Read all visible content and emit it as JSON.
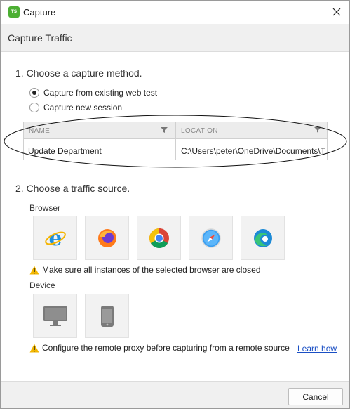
{
  "window": {
    "title": "Capture",
    "app_icon_text": "TS"
  },
  "header": {
    "title": "Capture Traffic"
  },
  "step1": {
    "heading": "1. Choose a capture method.",
    "options": [
      {
        "label": "Capture from existing web test",
        "checked": true
      },
      {
        "label": "Capture new session",
        "checked": false
      }
    ],
    "table": {
      "columns": [
        "NAME",
        "LOCATION"
      ],
      "rows": [
        {
          "name": "Update Department",
          "location": "C:\\Users\\peter\\OneDrive\\Documents\\Te"
        }
      ]
    }
  },
  "step2": {
    "heading": "2. Choose a traffic source.",
    "browser_label": "Browser",
    "browsers": [
      "internet-explorer-icon",
      "firefox-icon",
      "chrome-icon",
      "safari-icon",
      "edge-icon"
    ],
    "browser_warning": "Make sure all instances of the selected browser are closed",
    "device_label": "Device",
    "devices": [
      "desktop-icon",
      "mobile-icon"
    ],
    "device_warning": "Configure the remote proxy before capturing from a remote source",
    "learn_link": "Learn how"
  },
  "footer": {
    "cancel_label": "Cancel"
  },
  "colors": {
    "accent": "#4caf33",
    "link": "#1a4fc4",
    "warning": "#f2b600"
  }
}
